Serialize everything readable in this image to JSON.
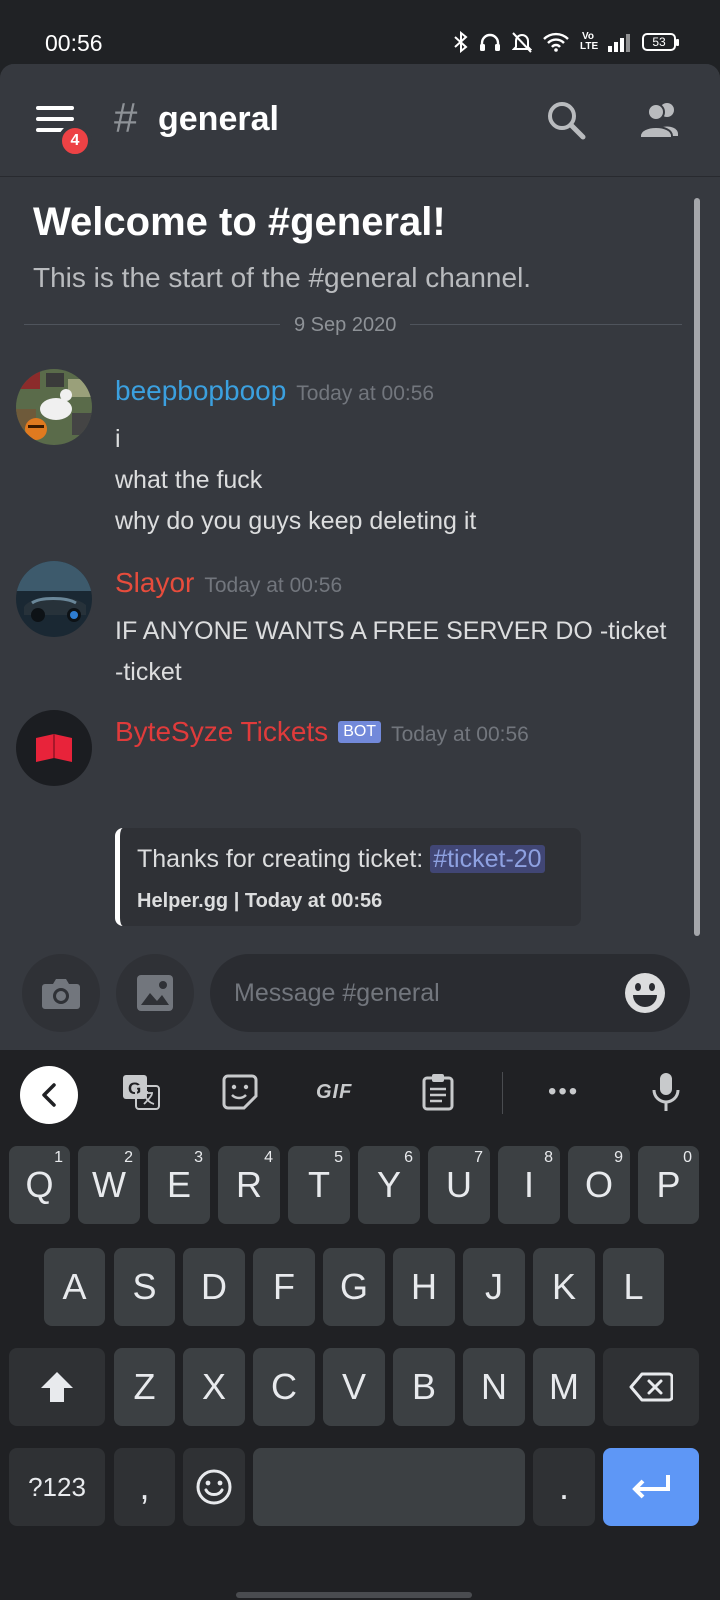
{
  "status_bar": {
    "time": "00:56",
    "network_label": "Vo LTE",
    "battery": "53"
  },
  "header": {
    "notification_count": "4",
    "hash": "#",
    "channel": "general"
  },
  "welcome": {
    "title": "Welcome to #general!",
    "subtitle": "This is the start of the #general channel.",
    "date_divider": "9 Sep 2020"
  },
  "messages": [
    {
      "author": "beepbopboop",
      "author_color": "#3ba0df",
      "timestamp": "Today at 00:56",
      "lines": [
        "i",
        "what the fuck",
        "why do you guys keep deleting it"
      ]
    },
    {
      "author": "Slayor",
      "author_color": "#e74c3c",
      "timestamp": "Today at 00:56",
      "lines": [
        "IF ANYONE WANTS A FREE SERVER DO -ticket",
        "-ticket"
      ]
    },
    {
      "author": "ByteSyze Tickets",
      "author_color": "#e03b3b",
      "bot_tag": "BOT",
      "timestamp": "Today at 00:56",
      "embed": {
        "text": "Thanks for creating ticket: ",
        "mention": "#ticket-20",
        "footer": "Helper.gg | Today at 00:56"
      }
    }
  ],
  "composer": {
    "placeholder": "Message #general"
  },
  "keyboard": {
    "toolbar": {
      "gif_label": "GIF",
      "more_label": "•••"
    },
    "row1": [
      {
        "key": "Q",
        "num": "1"
      },
      {
        "key": "W",
        "num": "2"
      },
      {
        "key": "E",
        "num": "3"
      },
      {
        "key": "R",
        "num": "4"
      },
      {
        "key": "T",
        "num": "5"
      },
      {
        "key": "Y",
        "num": "6"
      },
      {
        "key": "U",
        "num": "7"
      },
      {
        "key": "I",
        "num": "8"
      },
      {
        "key": "O",
        "num": "9"
      },
      {
        "key": "P",
        "num": "0"
      }
    ],
    "row2": [
      "A",
      "S",
      "D",
      "F",
      "G",
      "H",
      "J",
      "K",
      "L"
    ],
    "row3": [
      "Z",
      "X",
      "C",
      "V",
      "B",
      "N",
      "M"
    ],
    "row4": {
      "symbols": "?123",
      "comma": ",",
      "period": "."
    }
  },
  "colors": {
    "accent": "#5e97f6",
    "mention_bg": "#414675",
    "badge": "#ed4245",
    "bot_tag": "#7289da"
  }
}
